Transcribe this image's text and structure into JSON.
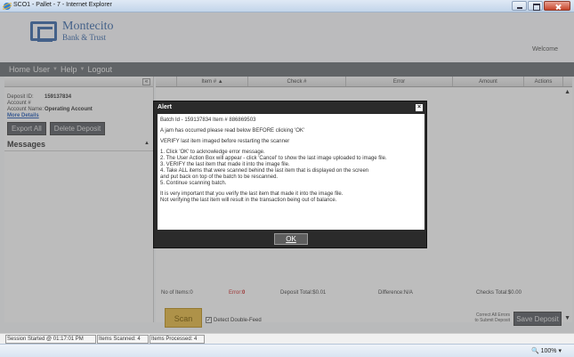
{
  "window": {
    "title": "SCO1 - Pallet - 7 - Internet Explorer"
  },
  "header": {
    "bank_line1": "Montecito",
    "bank_line2": "Bank & Trust",
    "welcome": "Welcome"
  },
  "nav": {
    "items": [
      "Home",
      "User",
      "Help",
      "Logout"
    ]
  },
  "deposit": {
    "id_label": "Deposit ID:",
    "id_value": "159137834",
    "account_no_label": "Account #",
    "account_name_label": "Account Name:",
    "account_name_value": "Operating Account",
    "more_details": "More Details",
    "export_all": "Export All",
    "delete_deposit": "Delete Deposit",
    "messages": "Messages"
  },
  "grid": {
    "columns": [
      "Item # ▲",
      "Check #",
      "Error",
      "Amount",
      "Actions"
    ]
  },
  "totals": {
    "num_items": "No of Items:0",
    "error_label": "Error:",
    "error_value": "0",
    "deposit_total": "Deposit Total:$0.01",
    "difference": "Difference:N/A",
    "checks_total": "Checks Total:$0.00"
  },
  "bottom": {
    "scan": "Scan",
    "detect_double_feed": "Detect Double-Feed",
    "correct_line1": "Correct All Errors",
    "correct_line2": "to Submit Deposit",
    "save_deposit": "Save Deposit"
  },
  "alert": {
    "title": "Alert",
    "close": "×",
    "batch_line": "Batch Id - 159137834 Item # 886869503",
    "jam_line": "A jam has occurred please read below BEFORE clicking 'OK'",
    "verify_line": "VERIFY last item imaged before restarting the scanner",
    "steps": [
      "1. Click 'OK' to acknowledge error message.",
      "2. The User Action Box will appear - click 'Cancel' to show the last image uploaded to image file.",
      "3. VERIFY the last item that made it into the image file.",
      "4. Take ALL items that were scanned behind the last item that is displayed on the screen",
      "and put back on top of the batch to be rescanned.",
      "5. Continue scanning batch."
    ],
    "important_1": "It is very important that you verify the last item that made it into the image file.",
    "important_2": "Not verifying the last item will result in the transaction being out of balance.",
    "ok_button": "OK"
  },
  "statusbar": {
    "session": "Session Started @ 01:17:01 PM",
    "scanned": "Items Scanned: 4",
    "processed": "Items Processed: 4"
  },
  "ie": {
    "zoom": "100%"
  },
  "colors": {
    "brand": "#3e6aa8",
    "nav_bg": "#6b6f74",
    "scan_btn": "#e0b546",
    "error": "#c62828"
  }
}
